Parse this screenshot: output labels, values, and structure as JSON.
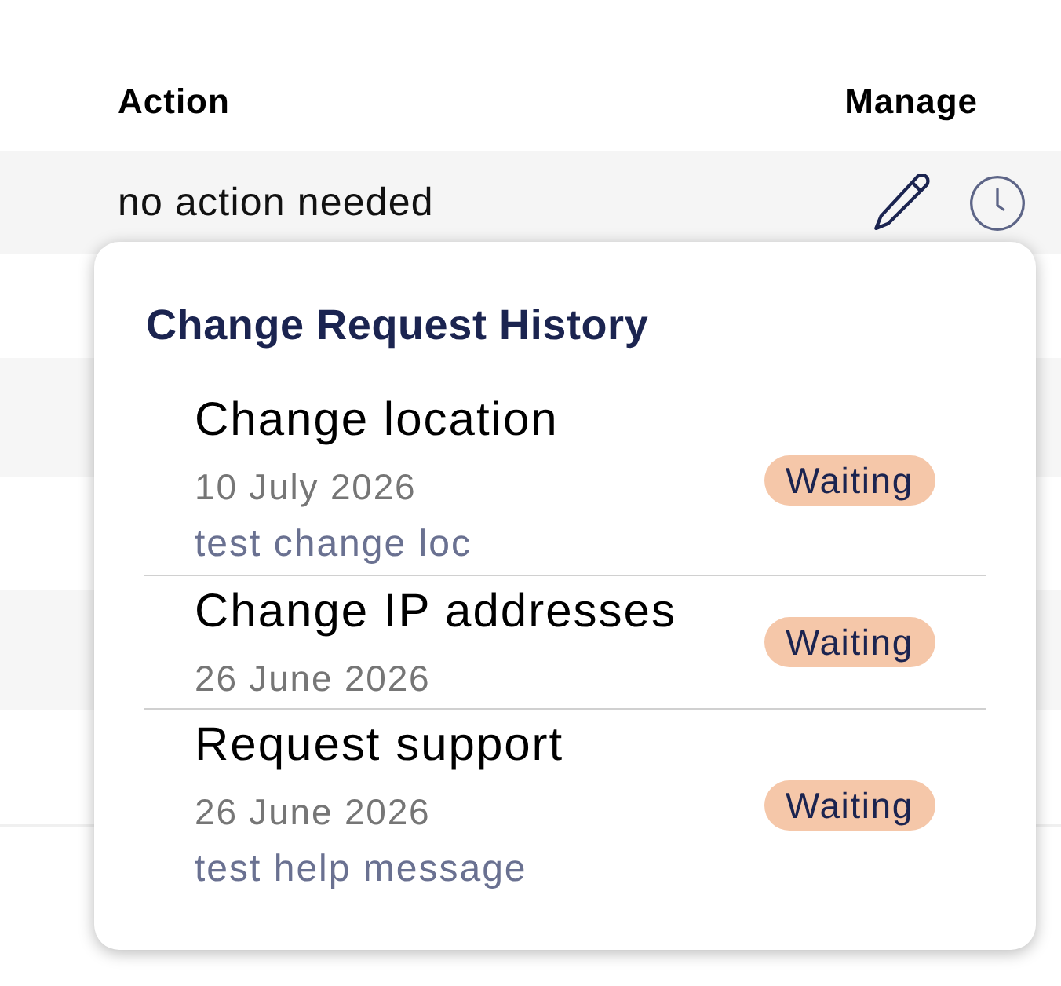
{
  "table": {
    "columns": [
      {
        "label": "Action"
      },
      {
        "label": "Manage"
      }
    ],
    "rows": [
      {
        "action": "no action needed"
      }
    ]
  },
  "history_popup": {
    "title": "Change Request History",
    "items": [
      {
        "title": "Change location",
        "date": "10 July 2026",
        "note": "test change loc",
        "status": "Waiting"
      },
      {
        "title": "Change IP addresses",
        "date": "26 June 2026",
        "status": "Waiting"
      },
      {
        "title": "Request support",
        "date": "26 June 2026",
        "note": "test help message",
        "status": "Waiting"
      }
    ]
  }
}
